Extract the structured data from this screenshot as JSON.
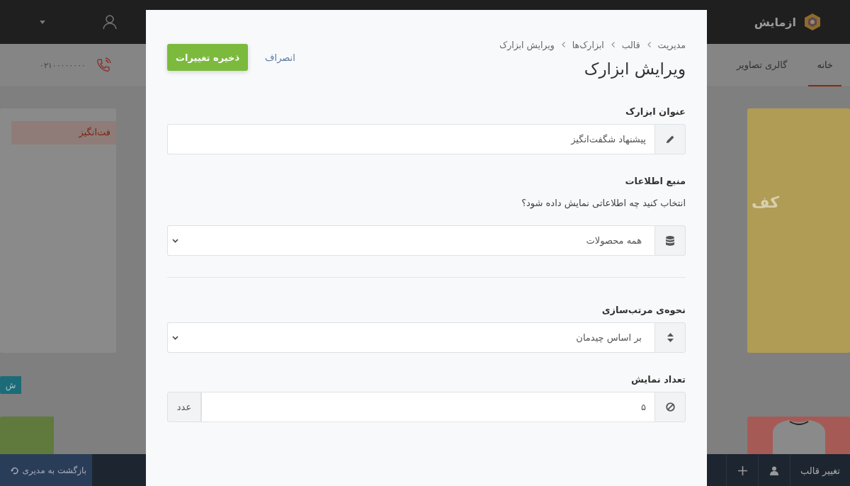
{
  "site": {
    "logo_text": "ازمایش",
    "nav": [
      {
        "label": "خانه",
        "selected": true
      },
      {
        "label": "گالری تصاویر",
        "selected": false
      }
    ],
    "phone": "۰۲۱۰۰۰۰۰۰۰۰",
    "left_card_text": "فت‌انگیز",
    "left_button_text": "ش",
    "right_card_text": "کف",
    "bottom_bar": {
      "back": "بازگشت به مدیری",
      "change_theme": "تغییر قالب"
    }
  },
  "modal": {
    "breadcrumb": [
      "مدیریت",
      "قالب",
      "ابزارک‌ها",
      "ویرایش ابزارک"
    ],
    "title": "ویرایش ابزارک",
    "cancel": "انصراف",
    "save": "ذخیره تغییرات",
    "fields": [
      {
        "kind": "text",
        "label": "عنوان ابزارک",
        "value": "پیشنهاد شگفت‌انگیز",
        "divider_after": false
      },
      {
        "kind": "select",
        "label": "منبع اطلاعات",
        "help": "انتخاب کنید چه اطلاعاتی نمایش داده شود؟",
        "value": "همه محصولات",
        "divider_after": true
      },
      {
        "kind": "select",
        "label": "نحوه‌ی مرتب‌سازی",
        "value": "بر اساس چیدمان",
        "divider_after": false
      },
      {
        "kind": "number",
        "label": "تعداد نمایش",
        "value": "۵",
        "suffix": "عدد",
        "divider_after": false
      }
    ]
  }
}
